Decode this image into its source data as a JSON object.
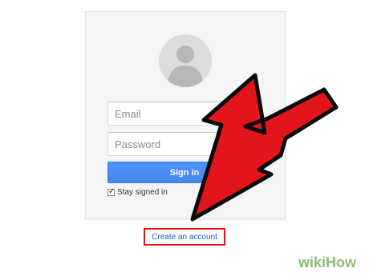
{
  "login": {
    "email_placeholder": "Email",
    "password_placeholder": "Password",
    "signin_label": "Sign in",
    "stay_signed_in_label": "Stay signed in",
    "stay_signed_in_checked": true
  },
  "create_account_label": "Create an account",
  "watermark_text": "wikiHow",
  "colors": {
    "card_bg": "#f5f5f5",
    "signin_blue": "#4d90fe",
    "link_blue": "#1a5fd1",
    "arrow_red": "#e4141d",
    "watermark_green": "#93b874"
  }
}
